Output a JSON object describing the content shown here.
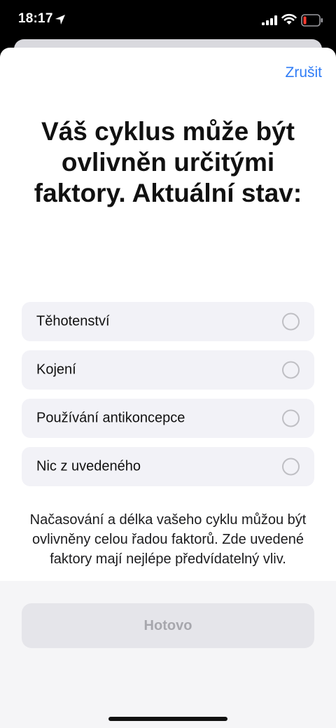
{
  "status_bar": {
    "time": "18:17",
    "icons": [
      "location-arrow-icon",
      "cellular-signal-icon",
      "wifi-icon",
      "battery-low-icon"
    ],
    "battery_color": "#ff3b30"
  },
  "sheet": {
    "cancel_label": "Zrušit",
    "title": "Váš cyklus může být ovlivněn určitými faktory. Aktuální stav:",
    "options": [
      {
        "label": "Těhotenství",
        "selected": false
      },
      {
        "label": "Kojení",
        "selected": false
      },
      {
        "label": "Používání antikoncepce",
        "selected": false
      },
      {
        "label": "Nic z uvedeného",
        "selected": false
      }
    ],
    "description": "Načasování a délka vašeho cyklu můžou být ovlivněny celou řadou faktorů. Zde uvedené faktory mají nejlépe předvídatelný vliv.",
    "done_label": "Hotovo"
  },
  "colors": {
    "accent": "#2f7cf6",
    "option_bg": "#f2f2f7",
    "done_disabled_bg": "#e5e5ea"
  }
}
